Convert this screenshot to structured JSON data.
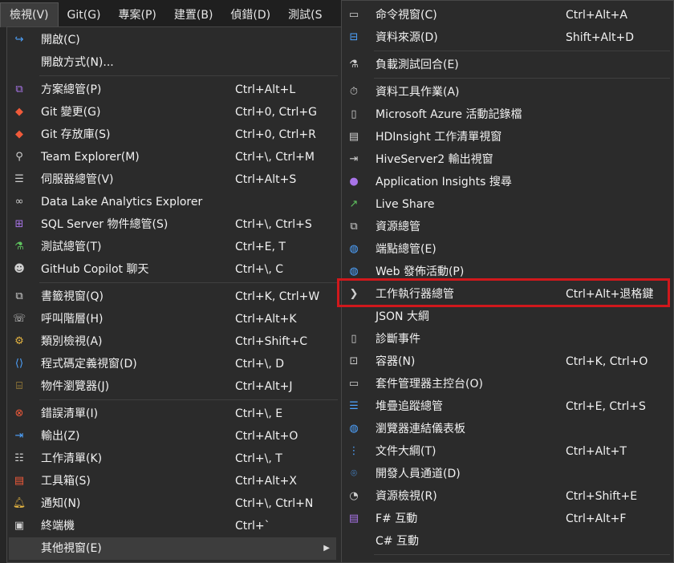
{
  "menubar": {
    "items": [
      {
        "label": "檢視(V)"
      },
      {
        "label": "Git(G)"
      },
      {
        "label": "專案(P)"
      },
      {
        "label": "建置(B)"
      },
      {
        "label": "偵錯(D)"
      },
      {
        "label": "測試(S"
      }
    ]
  },
  "view_menu": {
    "items": [
      {
        "label": "開啟(C)",
        "shortcut": "",
        "icon": "arrow-refresh-icon"
      },
      {
        "label": "開啟方式(N)...",
        "shortcut": "",
        "icon": ""
      },
      {
        "label": "方案總管(P)",
        "shortcut": "Ctrl+Alt+L",
        "icon": "solution-explorer-icon"
      },
      {
        "label": "Git 變更(G)",
        "shortcut": "Ctrl+0, Ctrl+G",
        "icon": "git-changes-icon"
      },
      {
        "label": "Git 存放庫(S)",
        "shortcut": "Ctrl+0, Ctrl+R",
        "icon": "git-repository-icon"
      },
      {
        "label": "Team Explorer(M)",
        "shortcut": "Ctrl+\\, Ctrl+M",
        "icon": "team-explorer-icon"
      },
      {
        "label": "伺服器總管(V)",
        "shortcut": "Ctrl+Alt+S",
        "icon": "server-explorer-icon"
      },
      {
        "label": "Data Lake Analytics Explorer",
        "shortcut": "",
        "icon": "data-lake-icon"
      },
      {
        "label": "SQL Server 物件總管(S)",
        "shortcut": "Ctrl+\\, Ctrl+S",
        "icon": "sql-server-icon"
      },
      {
        "label": "測試總管(T)",
        "shortcut": "Ctrl+E, T",
        "icon": "test-explorer-icon"
      },
      {
        "label": "GitHub Copilot 聊天",
        "shortcut": "Ctrl+\\, C",
        "icon": "copilot-icon"
      },
      {
        "label": "書籤視窗(Q)",
        "shortcut": "Ctrl+K, Ctrl+W",
        "icon": "bookmark-window-icon"
      },
      {
        "label": "呼叫階層(H)",
        "shortcut": "Ctrl+Alt+K",
        "icon": "call-hierarchy-icon"
      },
      {
        "label": "類別檢視(A)",
        "shortcut": "Ctrl+Shift+C",
        "icon": "class-view-icon"
      },
      {
        "label": "程式碼定義視窗(D)",
        "shortcut": "Ctrl+\\, D",
        "icon": "code-definition-icon"
      },
      {
        "label": "物件瀏覽器(J)",
        "shortcut": "Ctrl+Alt+J",
        "icon": "object-browser-icon"
      },
      {
        "label": "錯誤清單(I)",
        "shortcut": "Ctrl+\\, E",
        "icon": "error-list-icon"
      },
      {
        "label": "輸出(Z)",
        "shortcut": "Ctrl+Alt+O",
        "icon": "output-icon"
      },
      {
        "label": "工作清單(K)",
        "shortcut": "Ctrl+\\, T",
        "icon": "task-list-icon"
      },
      {
        "label": "工具箱(S)",
        "shortcut": "Ctrl+Alt+X",
        "icon": "toolbox-icon"
      },
      {
        "label": "通知(N)",
        "shortcut": "Ctrl+\\, Ctrl+N",
        "icon": "bell-icon"
      },
      {
        "label": "終端機",
        "shortcut": "Ctrl+`",
        "icon": "terminal-icon"
      },
      {
        "label": "其他視窗(E)",
        "shortcut": "",
        "icon": ""
      }
    ]
  },
  "other_windows_menu": {
    "items": [
      {
        "label": "命令視窗(C)",
        "shortcut": "Ctrl+Alt+A",
        "icon": "command-window-icon"
      },
      {
        "label": "資料來源(D)",
        "shortcut": "Shift+Alt+D",
        "icon": "data-sources-icon"
      },
      {
        "label": "負載測試回合(E)",
        "shortcut": "",
        "icon": "load-test-icon"
      },
      {
        "label": "資料工具作業(A)",
        "shortcut": "",
        "icon": "data-tools-icon"
      },
      {
        "label": "Microsoft Azure 活動記錄檔",
        "shortcut": "",
        "icon": "azure-log-icon"
      },
      {
        "label": "HDInsight 工作清單視窗",
        "shortcut": "",
        "icon": "hdinsight-icon"
      },
      {
        "label": "HiveServer2 輸出視窗",
        "shortcut": "",
        "icon": "hiveserver-icon"
      },
      {
        "label": "Application Insights 搜尋",
        "shortcut": "",
        "icon": "lightbulb-icon"
      },
      {
        "label": "Live Share",
        "shortcut": "",
        "icon": "live-share-icon"
      },
      {
        "label": "資源總管",
        "shortcut": "",
        "icon": "resource-explorer-icon"
      },
      {
        "label": "端點總管(E)",
        "shortcut": "",
        "icon": "globe-icon"
      },
      {
        "label": "Web 發佈活動(P)",
        "shortcut": "",
        "icon": "web-publish-icon"
      },
      {
        "label": "工作執行器總管",
        "shortcut": "Ctrl+Alt+退格鍵",
        "icon": "chevron-right-icon"
      },
      {
        "label": "JSON 大綱",
        "shortcut": "",
        "icon": ""
      },
      {
        "label": "診斷事件",
        "shortcut": "",
        "icon": "diagnostic-events-icon"
      },
      {
        "label": "容器(N)",
        "shortcut": "Ctrl+K, Ctrl+O",
        "icon": "container-icon"
      },
      {
        "label": "套件管理器主控台(O)",
        "shortcut": "",
        "icon": "package-console-icon"
      },
      {
        "label": "堆疊追蹤總管",
        "shortcut": "Ctrl+E, Ctrl+S",
        "icon": "stack-trace-icon"
      },
      {
        "label": "瀏覽器連結儀表板",
        "shortcut": "",
        "icon": "browser-link-icon"
      },
      {
        "label": "文件大綱(T)",
        "shortcut": "Ctrl+Alt+T",
        "icon": "document-outline-icon"
      },
      {
        "label": "開發人員通道(D)",
        "shortcut": "",
        "icon": "dev-tunnels-icon"
      },
      {
        "label": "資源檢視(R)",
        "shortcut": "Ctrl+Shift+E",
        "icon": "resource-view-icon"
      },
      {
        "label": "F# 互動",
        "shortcut": "Ctrl+Alt+F",
        "icon": "fsharp-interactive-icon"
      },
      {
        "label": "C# 互動",
        "shortcut": "",
        "icon": ""
      }
    ]
  }
}
